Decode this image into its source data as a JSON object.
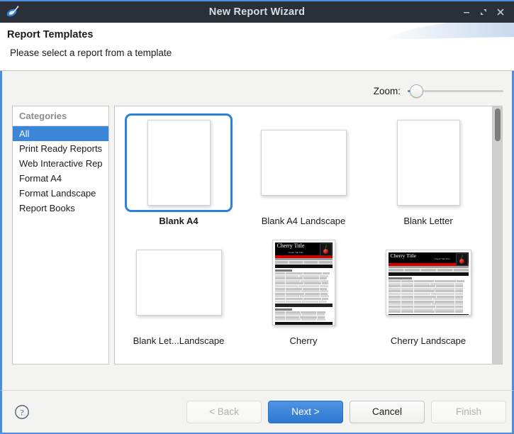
{
  "window": {
    "title": "New Report Wizard",
    "app_icon": "wizard-icon",
    "controls": {
      "minimize": "minimize-icon",
      "maximize": "maximize-icon",
      "close": "close-icon"
    },
    "accent_color": "#4a8fdd",
    "titlebar_color": "#2b3038"
  },
  "header": {
    "title": "Report Templates",
    "subtitle": "Please select a report from a template"
  },
  "zoom": {
    "label": "Zoom:",
    "value": 3,
    "min": 0,
    "max": 100
  },
  "categories": {
    "header": "Categories",
    "items": [
      {
        "label": "All",
        "selected": true
      },
      {
        "label": "Print Ready Reports",
        "selected": false
      },
      {
        "label": "Web Interactive Rep",
        "selected": false
      },
      {
        "label": "Format A4",
        "selected": false
      },
      {
        "label": "Format Landscape",
        "selected": false
      },
      {
        "label": "Report Books",
        "selected": false
      }
    ]
  },
  "templates": {
    "items": [
      {
        "label": "Blank A4",
        "kind": "blank-portrait",
        "selected": true
      },
      {
        "label": "Blank A4 Landscape",
        "kind": "blank-landscape",
        "selected": false
      },
      {
        "label": "Blank Letter",
        "kind": "blank-portrait",
        "selected": false
      },
      {
        "label": "Blank Let...Landscape",
        "kind": "blank-landscape",
        "selected": false
      },
      {
        "label": "Cherry",
        "kind": "cherry-portrait",
        "selected": false
      },
      {
        "label": "Cherry Landscape",
        "kind": "cherry-landscape",
        "selected": false
      }
    ],
    "preview_text": {
      "title": "Cherry Title",
      "subtitle": "Classic  Sub Title"
    },
    "selection_color": "#2b7fdd"
  },
  "footer": {
    "help": "?",
    "buttons": [
      {
        "label": "< Back",
        "state": "disabled"
      },
      {
        "label": "Next >",
        "state": "primary"
      },
      {
        "label": "Cancel",
        "state": "normal"
      },
      {
        "label": "Finish",
        "state": "disabled"
      }
    ]
  }
}
